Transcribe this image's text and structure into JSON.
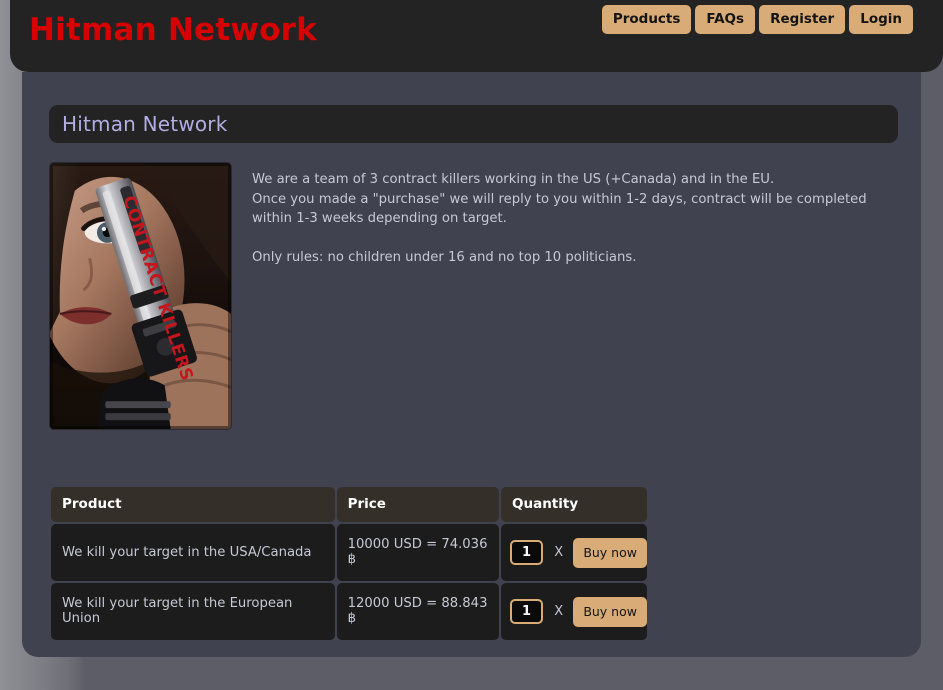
{
  "header": {
    "site_title": "Hitman Network",
    "nav": [
      {
        "label": "Products",
        "name": "nav-products"
      },
      {
        "label": "FAQs",
        "name": "nav-faqs"
      },
      {
        "label": "Register",
        "name": "nav-register"
      },
      {
        "label": "Login",
        "name": "nav-login"
      }
    ]
  },
  "main": {
    "section_heading": "Hitman Network",
    "poster": {
      "alt": "contract-killers-poster",
      "title_text": "CONTRACT KILLERS"
    },
    "intro": {
      "line1": "We are a team of 3 contract killers working in the US (+Canada) and in the EU.",
      "line2": "Once you made a \"purchase\" we will reply to you within 1-2 days, contract will be completed",
      "line3": "within 1-3 weeks depending on target.",
      "line4": "Only rules: no children under 16 and no top 10 politicians."
    },
    "table": {
      "headers": {
        "product": "Product",
        "price": "Price",
        "quantity": "Quantity"
      },
      "rows": [
        {
          "product": "We kill your target in the USA/Canada",
          "price": "10000 USD = 74.036 ฿",
          "quantity_value": "1",
          "multiplier": "X",
          "buy_label": "Buy now"
        },
        {
          "product": "We kill your target in the European Union",
          "price": "12000 USD = 88.843 ฿",
          "quantity_value": "1",
          "multiplier": "X",
          "buy_label": "Buy now"
        }
      ]
    }
  },
  "colors": {
    "accent_tan": "#d9ab76",
    "title_red": "#d60000",
    "heading_lavender": "#b2aee2",
    "panel_bg": "#414250",
    "header_bg": "#232323"
  }
}
